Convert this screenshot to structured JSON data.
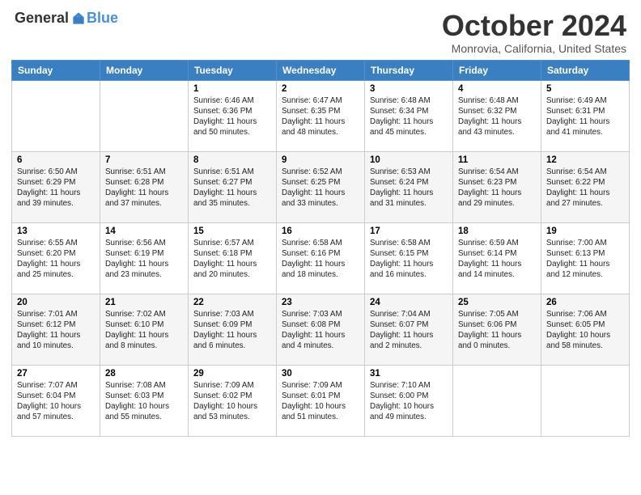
{
  "header": {
    "logo_general": "General",
    "logo_blue": "Blue",
    "title": "October 2024",
    "subtitle": "Monrovia, California, United States"
  },
  "weekdays": [
    "Sunday",
    "Monday",
    "Tuesday",
    "Wednesday",
    "Thursday",
    "Friday",
    "Saturday"
  ],
  "weeks": [
    [
      {
        "day": "",
        "info": ""
      },
      {
        "day": "",
        "info": ""
      },
      {
        "day": "1",
        "info": "Sunrise: 6:46 AM\nSunset: 6:36 PM\nDaylight: 11 hours and 50 minutes."
      },
      {
        "day": "2",
        "info": "Sunrise: 6:47 AM\nSunset: 6:35 PM\nDaylight: 11 hours and 48 minutes."
      },
      {
        "day": "3",
        "info": "Sunrise: 6:48 AM\nSunset: 6:34 PM\nDaylight: 11 hours and 45 minutes."
      },
      {
        "day": "4",
        "info": "Sunrise: 6:48 AM\nSunset: 6:32 PM\nDaylight: 11 hours and 43 minutes."
      },
      {
        "day": "5",
        "info": "Sunrise: 6:49 AM\nSunset: 6:31 PM\nDaylight: 11 hours and 41 minutes."
      }
    ],
    [
      {
        "day": "6",
        "info": "Sunrise: 6:50 AM\nSunset: 6:29 PM\nDaylight: 11 hours and 39 minutes."
      },
      {
        "day": "7",
        "info": "Sunrise: 6:51 AM\nSunset: 6:28 PM\nDaylight: 11 hours and 37 minutes."
      },
      {
        "day": "8",
        "info": "Sunrise: 6:51 AM\nSunset: 6:27 PM\nDaylight: 11 hours and 35 minutes."
      },
      {
        "day": "9",
        "info": "Sunrise: 6:52 AM\nSunset: 6:25 PM\nDaylight: 11 hours and 33 minutes."
      },
      {
        "day": "10",
        "info": "Sunrise: 6:53 AM\nSunset: 6:24 PM\nDaylight: 11 hours and 31 minutes."
      },
      {
        "day": "11",
        "info": "Sunrise: 6:54 AM\nSunset: 6:23 PM\nDaylight: 11 hours and 29 minutes."
      },
      {
        "day": "12",
        "info": "Sunrise: 6:54 AM\nSunset: 6:22 PM\nDaylight: 11 hours and 27 minutes."
      }
    ],
    [
      {
        "day": "13",
        "info": "Sunrise: 6:55 AM\nSunset: 6:20 PM\nDaylight: 11 hours and 25 minutes."
      },
      {
        "day": "14",
        "info": "Sunrise: 6:56 AM\nSunset: 6:19 PM\nDaylight: 11 hours and 23 minutes."
      },
      {
        "day": "15",
        "info": "Sunrise: 6:57 AM\nSunset: 6:18 PM\nDaylight: 11 hours and 20 minutes."
      },
      {
        "day": "16",
        "info": "Sunrise: 6:58 AM\nSunset: 6:16 PM\nDaylight: 11 hours and 18 minutes."
      },
      {
        "day": "17",
        "info": "Sunrise: 6:58 AM\nSunset: 6:15 PM\nDaylight: 11 hours and 16 minutes."
      },
      {
        "day": "18",
        "info": "Sunrise: 6:59 AM\nSunset: 6:14 PM\nDaylight: 11 hours and 14 minutes."
      },
      {
        "day": "19",
        "info": "Sunrise: 7:00 AM\nSunset: 6:13 PM\nDaylight: 11 hours and 12 minutes."
      }
    ],
    [
      {
        "day": "20",
        "info": "Sunrise: 7:01 AM\nSunset: 6:12 PM\nDaylight: 11 hours and 10 minutes."
      },
      {
        "day": "21",
        "info": "Sunrise: 7:02 AM\nSunset: 6:10 PM\nDaylight: 11 hours and 8 minutes."
      },
      {
        "day": "22",
        "info": "Sunrise: 7:03 AM\nSunset: 6:09 PM\nDaylight: 11 hours and 6 minutes."
      },
      {
        "day": "23",
        "info": "Sunrise: 7:03 AM\nSunset: 6:08 PM\nDaylight: 11 hours and 4 minutes."
      },
      {
        "day": "24",
        "info": "Sunrise: 7:04 AM\nSunset: 6:07 PM\nDaylight: 11 hours and 2 minutes."
      },
      {
        "day": "25",
        "info": "Sunrise: 7:05 AM\nSunset: 6:06 PM\nDaylight: 11 hours and 0 minutes."
      },
      {
        "day": "26",
        "info": "Sunrise: 7:06 AM\nSunset: 6:05 PM\nDaylight: 10 hours and 58 minutes."
      }
    ],
    [
      {
        "day": "27",
        "info": "Sunrise: 7:07 AM\nSunset: 6:04 PM\nDaylight: 10 hours and 57 minutes."
      },
      {
        "day": "28",
        "info": "Sunrise: 7:08 AM\nSunset: 6:03 PM\nDaylight: 10 hours and 55 minutes."
      },
      {
        "day": "29",
        "info": "Sunrise: 7:09 AM\nSunset: 6:02 PM\nDaylight: 10 hours and 53 minutes."
      },
      {
        "day": "30",
        "info": "Sunrise: 7:09 AM\nSunset: 6:01 PM\nDaylight: 10 hours and 51 minutes."
      },
      {
        "day": "31",
        "info": "Sunrise: 7:10 AM\nSunset: 6:00 PM\nDaylight: 10 hours and 49 minutes."
      },
      {
        "day": "",
        "info": ""
      },
      {
        "day": "",
        "info": ""
      }
    ]
  ]
}
